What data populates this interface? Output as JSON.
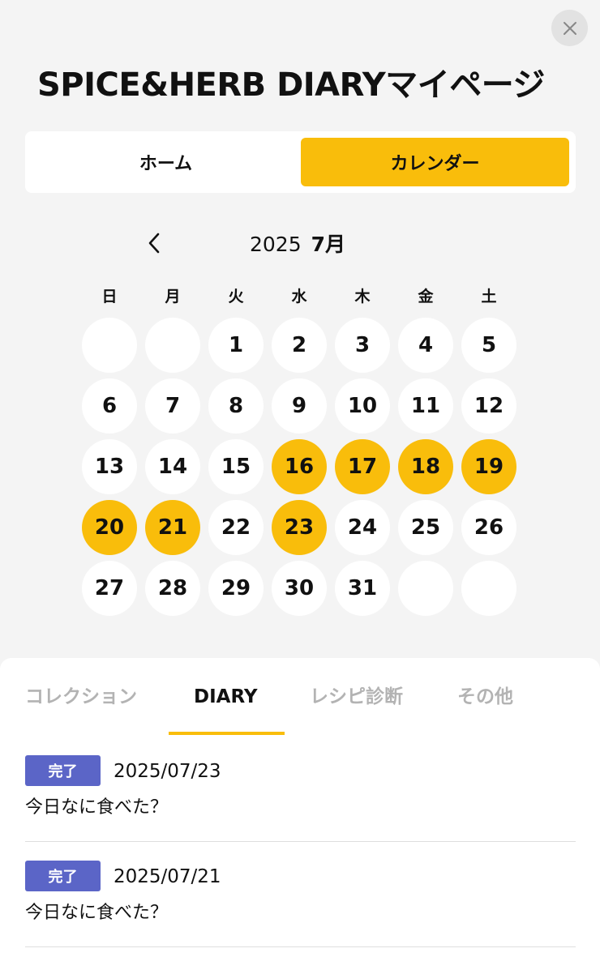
{
  "header": {
    "title": "SPICE&HERB DIARYマイページ",
    "close_icon": "close-icon"
  },
  "view_toggle": {
    "options": [
      "ホーム",
      "カレンダー"
    ],
    "selected": "カレンダー",
    "accent_color": "#f9bd0b"
  },
  "calendar": {
    "year": "2025",
    "month": "7月",
    "prev_icon": "chevron-left-icon",
    "weekdays": [
      "日",
      "月",
      "火",
      "水",
      "木",
      "金",
      "土"
    ],
    "leading_blank_days": 2,
    "trailing_blank_days": 2,
    "days": [
      "1",
      "2",
      "3",
      "4",
      "5",
      "6",
      "7",
      "8",
      "9",
      "10",
      "11",
      "12",
      "13",
      "14",
      "15",
      "16",
      "17",
      "18",
      "19",
      "20",
      "21",
      "22",
      "23",
      "24",
      "25",
      "26",
      "27",
      "28",
      "29",
      "30",
      "31"
    ],
    "marked_days": [
      "16",
      "17",
      "18",
      "19",
      "20",
      "21",
      "23"
    ],
    "marked_color": "#f9bd0b"
  },
  "tabs": {
    "items": [
      "コレクション",
      "DIARY",
      "レシピ診断",
      "その他"
    ],
    "active": "DIARY"
  },
  "diary_entries": [
    {
      "status": "完了",
      "date": "2025/07/23",
      "question": "今日なに食べた？"
    },
    {
      "status": "完了",
      "date": "2025/07/21",
      "question": "今日なに食べた？"
    }
  ],
  "badge_color": "#5b65c7"
}
